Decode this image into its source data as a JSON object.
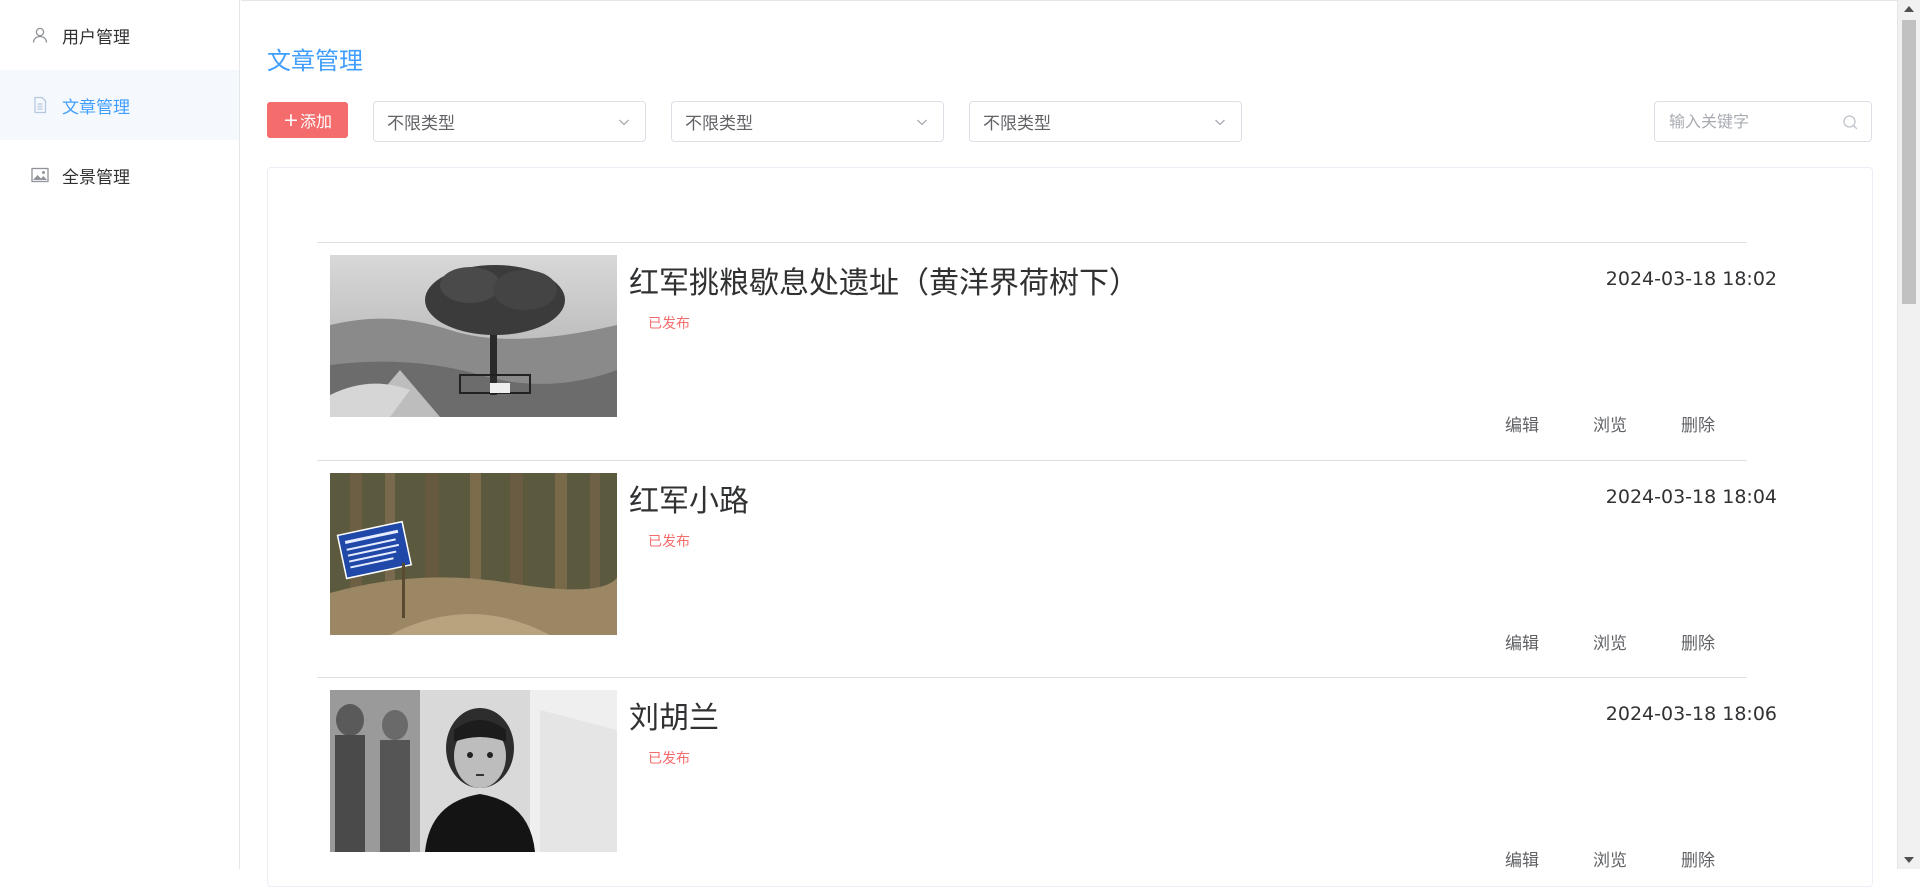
{
  "sidebar": {
    "items": [
      {
        "label": "用户管理",
        "icon": "user-icon"
      },
      {
        "label": "文章管理",
        "icon": "document-icon",
        "active": true
      },
      {
        "label": "全景管理",
        "icon": "image-icon"
      }
    ]
  },
  "main": {
    "title": "文章管理",
    "toolbar": {
      "add_label": "添加",
      "add_plus": "+",
      "filters": [
        "不限类型",
        "不限类型",
        "不限类型"
      ],
      "search_placeholder": "输入关键字"
    },
    "articles": [
      {
        "title": "红军挑粮歇息处遗址（黄洋界荷树下）",
        "status": "已发布",
        "date": "2024-03-18 18:02",
        "actions": [
          "编辑",
          "浏览",
          "删除"
        ]
      },
      {
        "title": "红军小路",
        "status": "已发布",
        "date": "2024-03-18 18:04",
        "actions": [
          "编辑",
          "浏览",
          "删除"
        ]
      },
      {
        "title": "刘胡兰",
        "status": "已发布",
        "date": "2024-03-18 18:06",
        "actions": [
          "编辑",
          "浏览",
          "删除"
        ]
      }
    ]
  },
  "colors": {
    "accent": "#409eff",
    "danger": "#f56c6c",
    "border": "#dcdfe6"
  }
}
